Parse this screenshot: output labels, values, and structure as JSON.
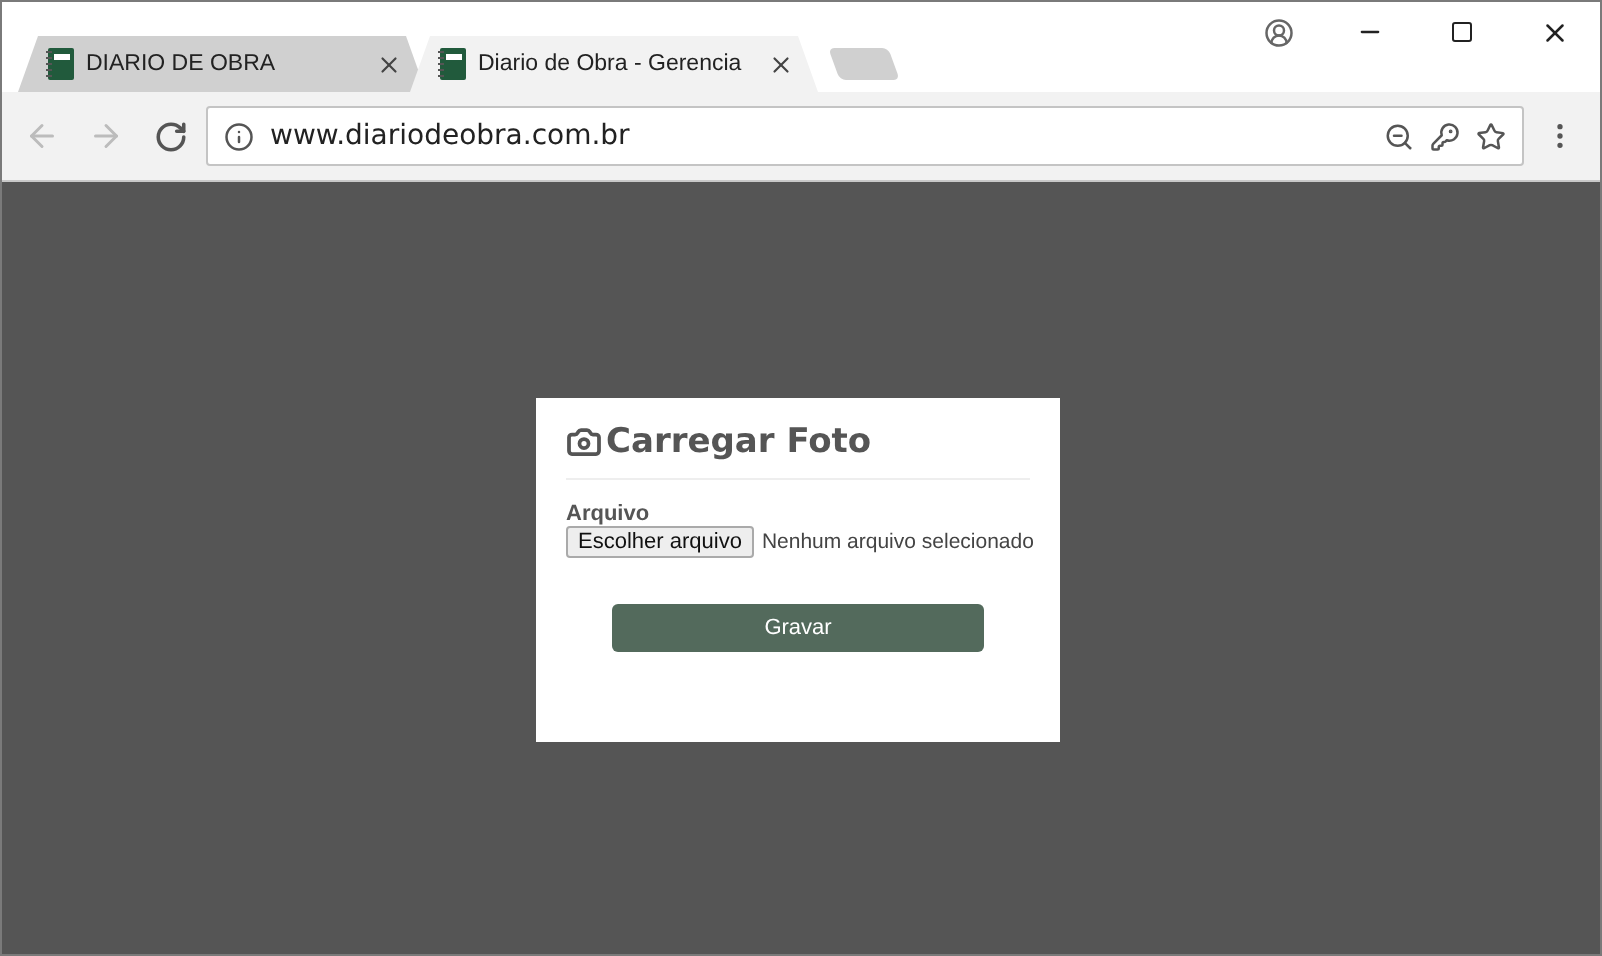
{
  "tabs": [
    {
      "label": "DIARIO DE OBRA",
      "selected": false
    },
    {
      "label": "Diario de Obra - Gerencia",
      "selected": true
    }
  ],
  "address_bar": {
    "url": "www.diariodeobra.com.br"
  },
  "dialog": {
    "title": "Carregar Foto",
    "field_label": "Arquivo",
    "file_button": "Escolher arquivo",
    "file_status": "Nenhum arquivo selecionado",
    "save_button": "Gravar"
  }
}
